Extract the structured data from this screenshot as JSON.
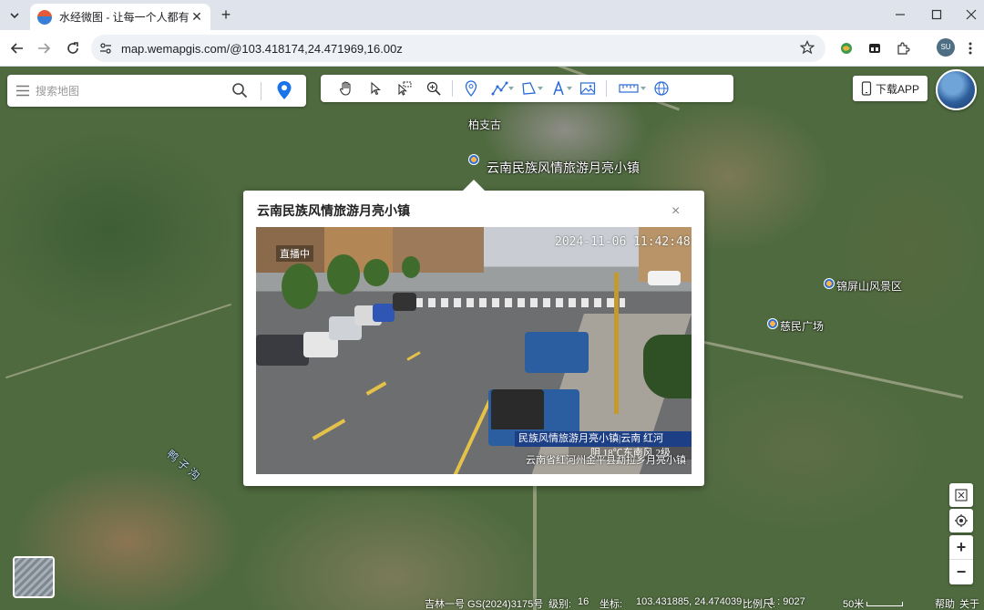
{
  "browser": {
    "tab_title": "水经微图 - 让每一个人都有自己",
    "url": "map.wemapgis.com/@103.418174,24.471969,16.00z",
    "profile_initials": "SU"
  },
  "search": {
    "placeholder": "搜索地图"
  },
  "download_label": "下载APP",
  "map_labels": {
    "village": "柏支古",
    "town": "云南民族风情旅游月亮小镇",
    "scenic": "锦屏山风景区",
    "plaza": "慈民广场",
    "river": "鸭 子 沟"
  },
  "popup": {
    "title": "云南民族风情旅游月亮小镇",
    "close_symbol": "×",
    "camera": {
      "timestamp": "2024-11-06 11:42:48",
      "live_tag": "直播中",
      "banner": "民族风情旅游月亮小镇|云南 红河",
      "weather": "阴 18℃东南风 2级",
      "caption": "云南省红河州金平县勐拉乡月亮小镇"
    }
  },
  "status": {
    "provider": "吉林一号 GS(2024)3175号",
    "zoom_label": "级别:",
    "zoom_value": "16",
    "coord_label": "坐标:",
    "coord_value": "103.431885, 24.474039",
    "scale_label": "比例尺:",
    "scale_value": "1 : 9027",
    "scale_bar_text": "50米",
    "help": "帮助",
    "about": "关于"
  },
  "controls": {
    "zoom_in": "+",
    "zoom_out": "−"
  },
  "colors": {
    "accent": "#1a73e8",
    "banner": "#1d3f86",
    "marker": "#1a73e8"
  }
}
